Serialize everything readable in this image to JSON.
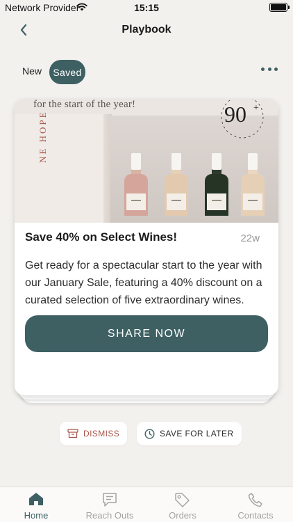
{
  "status_bar": {
    "provider": "Network Provider",
    "time": "15:15"
  },
  "header": {
    "title": "Playbook",
    "back_icon": "chevron-left-icon",
    "more_icon": "ellipsis-icon"
  },
  "filters": {
    "new_label": "New",
    "saved_label": "Saved",
    "selected": "Saved"
  },
  "card": {
    "image": {
      "caption": "for the start of the year!",
      "brand_text": "NE HOPE",
      "seal_number": "90",
      "seal_plus": "+"
    },
    "headline": "Save 40% on Select Wines!",
    "age": "22w",
    "body": "Get ready for a spectacular start to the year with our January Sale, featuring a 40% discount on a curated selection of five extraordinary wines.",
    "share_label": "SHARE NOW"
  },
  "actions": {
    "dismiss_label": "DISMISS",
    "dismiss_icon": "archive-box-icon",
    "save_label": "SAVE FOR LATER",
    "save_icon": "clock-icon"
  },
  "tabs": [
    {
      "label": "Home",
      "icon": "home-icon",
      "active": true
    },
    {
      "label": "Reach Outs",
      "icon": "chat-icon",
      "active": false
    },
    {
      "label": "Orders",
      "icon": "tag-icon",
      "active": false
    },
    {
      "label": "Contacts",
      "icon": "phone-icon",
      "active": false
    }
  ],
  "colors": {
    "accent": "#3e6063",
    "background": "#f3f1ee",
    "dismiss": "#a8564c"
  }
}
